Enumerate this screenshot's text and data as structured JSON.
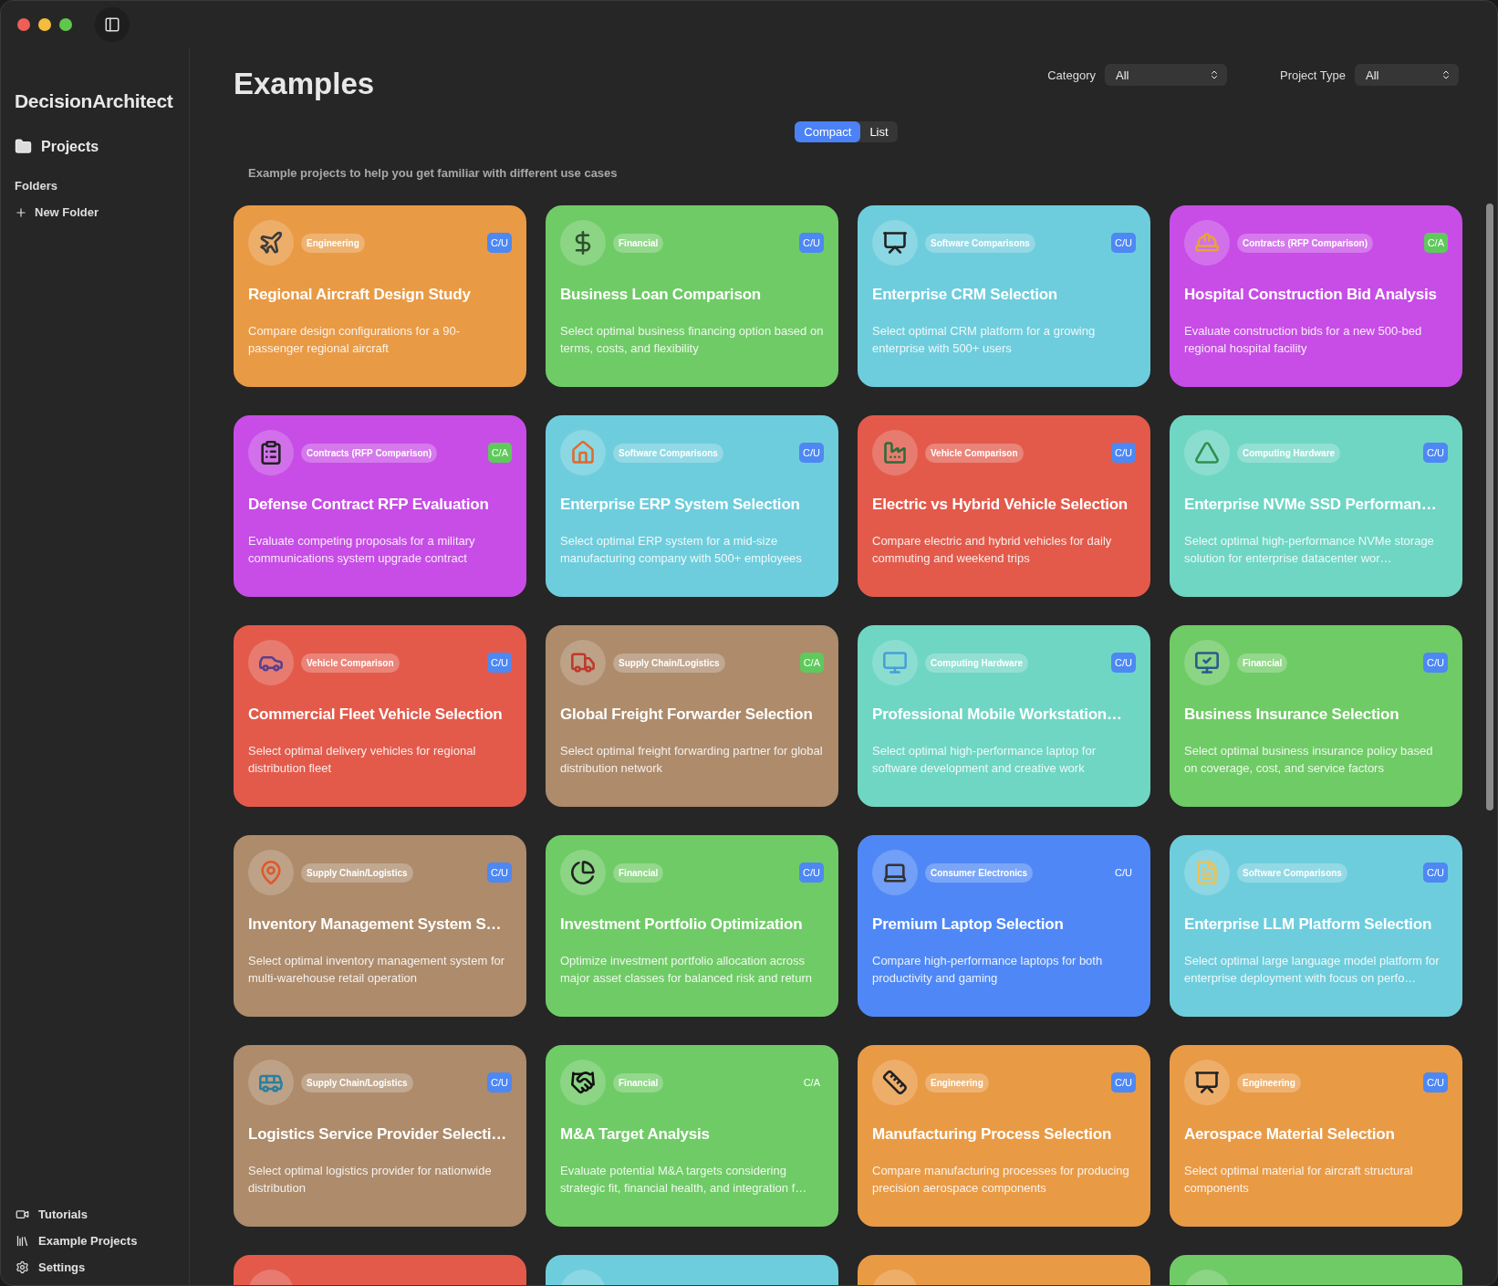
{
  "sidebar": {
    "app_name": "DecisionArchitect",
    "nav": [
      {
        "label": "Projects"
      }
    ],
    "folders_heading": "Folders",
    "new_folder": "New Folder",
    "footer": [
      {
        "label": "Tutorials"
      },
      {
        "label": "Example Projects"
      },
      {
        "label": "Settings"
      }
    ]
  },
  "header": {
    "title": "Examples",
    "filters": [
      {
        "label": "Category",
        "value": "All"
      },
      {
        "label": "Project Type",
        "value": "All"
      }
    ],
    "view_modes": [
      {
        "label": "Compact",
        "selected": true
      },
      {
        "label": "List",
        "selected": false
      }
    ],
    "subtitle": "Example projects to help you get familiar with different use cases"
  },
  "cards": [
    {
      "color": "#e99a45",
      "category": "Engineering",
      "badge": {
        "label": "C/U",
        "color": "#4d88f3"
      },
      "title": "Regional Aircraft Design Study",
      "description": "Compare design configurations for a 90-passenger regional aircraft"
    },
    {
      "color": "#6fcb66",
      "category": "Financial",
      "badge": {
        "label": "C/U",
        "color": "#4d88f3"
      },
      "title": "Business Loan Comparison",
      "description": "Select optimal business financing option based on terms, costs, and flexibility"
    },
    {
      "color": "#6ecddc",
      "category": "Software Comparisons",
      "badge": {
        "label": "C/U",
        "color": "#4d88f3"
      },
      "title": "Enterprise CRM Selection",
      "description": "Select optimal CRM platform for a growing enterprise with 500+ users"
    },
    {
      "color": "#c74de6",
      "category": "Contracts (RFP Comparison)",
      "badge": {
        "label": "C/A",
        "color": "#5fc95c"
      },
      "title": "Hospital Construction Bid Analysis",
      "description": "Evaluate construction bids for a new 500-bed regional hospital facility"
    },
    {
      "color": "#c74de6",
      "category": "Contracts (RFP Comparison)",
      "badge": {
        "label": "C/A",
        "color": "#5fc95c"
      },
      "title": "Defense Contract RFP Evaluation",
      "description": "Evaluate competing proposals for a military communications system upgrade contract"
    },
    {
      "color": "#6ecddc",
      "category": "Software Comparisons",
      "badge": {
        "label": "C/U",
        "color": "#4d88f3"
      },
      "title": "Enterprise ERP System Selection",
      "description": "Select optimal ERP system for a mid-size manufacturing company with 500+ employees"
    },
    {
      "color": "#e35a4b",
      "category": "Vehicle Comparison",
      "badge": {
        "label": "C/U",
        "color": "#4d88f3"
      },
      "title": "Electric vs Hybrid Vehicle Selection",
      "description": "Compare electric and hybrid vehicles for daily commuting and weekend trips"
    },
    {
      "color": "#6fd6c4",
      "category": "Computing Hardware",
      "badge": {
        "label": "C/U",
        "color": "#4d88f3"
      },
      "title": "Enterprise NVMe SSD Performan…",
      "description": "Select optimal high-performance NVMe storage solution for enterprise datacenter wor…"
    },
    {
      "color": "#e35a4b",
      "category": "Vehicle Comparison",
      "badge": {
        "label": "C/U",
        "color": "#4d88f3"
      },
      "title": "Commercial Fleet Vehicle Selection",
      "description": "Select optimal delivery vehicles for regional distribution fleet"
    },
    {
      "color": "#ad8b6b",
      "category": "Supply Chain/Logistics",
      "badge": {
        "label": "C/A",
        "color": "#5fc95c"
      },
      "title": "Global Freight Forwarder Selection",
      "description": "Select optimal freight forwarding partner for global distribution network"
    },
    {
      "color": "#6fd6c4",
      "category": "Computing Hardware",
      "badge": {
        "label": "C/U",
        "color": "#4d88f3"
      },
      "title": "Professional Mobile Workstation…",
      "description": "Select optimal high-performance laptop for software development and creative work"
    },
    {
      "color": "#6fcb66",
      "category": "Financial",
      "badge": {
        "label": "C/U",
        "color": "#4d88f3"
      },
      "title": "Business Insurance Selection",
      "description": "Select optimal business insurance policy based on coverage, cost, and service factors"
    },
    {
      "color": "#ad8b6b",
      "category": "Supply Chain/Logistics",
      "badge": {
        "label": "C/U",
        "color": "#4d88f3"
      },
      "title": "Inventory Management System S…",
      "description": "Select optimal inventory management system for multi-warehouse retail operation"
    },
    {
      "color": "#6fcb66",
      "category": "Financial",
      "badge": {
        "label": "C/U",
        "color": "#4d88f3"
      },
      "title": "Investment Portfolio Optimization",
      "description": "Optimize investment portfolio allocation across major asset classes for balanced risk and return"
    },
    {
      "color": "#4f88f6",
      "category": "Consumer Electronics",
      "badge": {
        "label": "C/U"
      },
      "title": "Premium Laptop Selection",
      "description": "Compare high-performance laptops for both productivity and gaming"
    },
    {
      "color": "#6ecddc",
      "category": "Software Comparisons",
      "badge": {
        "label": "C/U",
        "color": "#4d88f3"
      },
      "title": "Enterprise LLM Platform Selection",
      "description": "Select optimal large language model platform for enterprise deployment with focus on perfo…"
    },
    {
      "color": "#ad8b6b",
      "category": "Supply Chain/Logistics",
      "badge": {
        "label": "C/U",
        "color": "#4d88f3"
      },
      "title": "Logistics Service Provider Selecti…",
      "description": "Select optimal logistics provider for nationwide distribution"
    },
    {
      "color": "#6fcb66",
      "category": "Financial",
      "badge": {
        "label": "C/A"
      },
      "title": "M&A Target Analysis",
      "description": "Evaluate potential M&A targets considering strategic fit, financial health, and integration f…"
    },
    {
      "color": "#e99a45",
      "category": "Engineering",
      "badge": {
        "label": "C/U",
        "color": "#4d88f3"
      },
      "title": "Manufacturing Process Selection",
      "description": "Compare manufacturing processes for producing precision aerospace components"
    },
    {
      "color": "#e99a45",
      "category": "Engineering",
      "badge": {
        "label": "C/U",
        "color": "#4d88f3"
      },
      "title": "Aerospace Material Selection",
      "description": "Select optimal material for aircraft structural components"
    },
    {
      "color": "#e35a4b"
    },
    {
      "color": "#6ecddc"
    },
    {
      "color": "#e99a45"
    },
    {
      "color": "#6fcb66"
    }
  ]
}
